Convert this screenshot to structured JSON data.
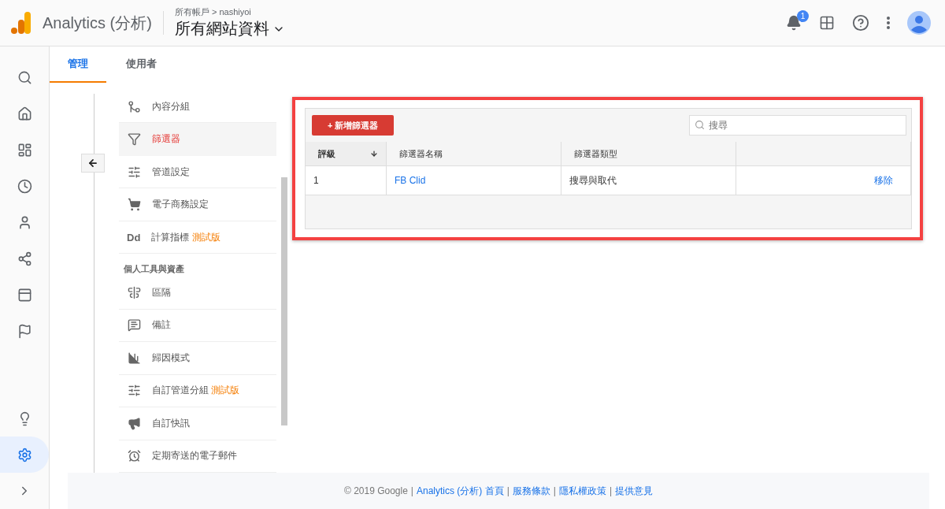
{
  "header": {
    "product": "Analytics (分析)",
    "breadcrumb": "所有帳戶 > nashiyoi",
    "view": "所有網站資料",
    "notifications": "1"
  },
  "rail": [
    {
      "selected": false
    },
    {
      "selected": false
    },
    {
      "selected": false
    },
    {
      "selected": false
    },
    {
      "selected": false
    },
    {
      "selected": false
    },
    {
      "selected": false
    },
    {
      "selected": false
    },
    {
      "selected": false
    },
    {
      "selected": true
    }
  ],
  "tabs": [
    {
      "label": "管理",
      "selected": true
    },
    {
      "label": "使用者",
      "selected": false
    }
  ],
  "menu": [
    {
      "label": "內容分組",
      "selected": false
    },
    {
      "label": "篩選器",
      "selected": true
    },
    {
      "label": "管道設定",
      "selected": false
    },
    {
      "label": "電子商務設定",
      "selected": false
    },
    {
      "label": "計算指標",
      "badge": "測試版",
      "icon_text": "Dd",
      "selected": false
    },
    {
      "kind": "section",
      "label": "個人工具與資產"
    },
    {
      "label": "區隔",
      "selected": false
    },
    {
      "label": "備註",
      "selected": false
    },
    {
      "label": "歸因模式",
      "selected": false
    },
    {
      "label": "自訂管道分組",
      "badge": "測試版",
      "selected": false
    },
    {
      "label": "自訂快訊",
      "selected": false
    },
    {
      "label": "定期寄送的電子郵件",
      "selected": false
    }
  ],
  "toolbar": {
    "add_button": "+ 新增篩選器",
    "search": {
      "placeholder": "搜尋"
    }
  },
  "table": {
    "columns": [
      {
        "label": "評級",
        "sorted": true
      },
      {
        "label": "篩選器名稱",
        "sorted": false
      },
      {
        "label": "篩選器類型",
        "sorted": false
      }
    ],
    "rows": [
      {
        "rank": "1",
        "name": "FB Clid",
        "type": "搜尋與取代",
        "action": "移除"
      }
    ]
  },
  "footer": [
    {
      "kind": "text",
      "text": "© 2019 Google"
    },
    {
      "kind": "separator",
      "text": "|"
    },
    {
      "kind": "link",
      "text": "Analytics (分析) 首頁"
    },
    {
      "kind": "separator",
      "text": "|"
    },
    {
      "kind": "link",
      "text": "服務條款"
    },
    {
      "kind": "separator",
      "text": "|"
    },
    {
      "kind": "link",
      "text": "隱私權政策"
    },
    {
      "kind": "separator",
      "text": "|"
    },
    {
      "kind": "link",
      "text": "提供意見"
    }
  ]
}
